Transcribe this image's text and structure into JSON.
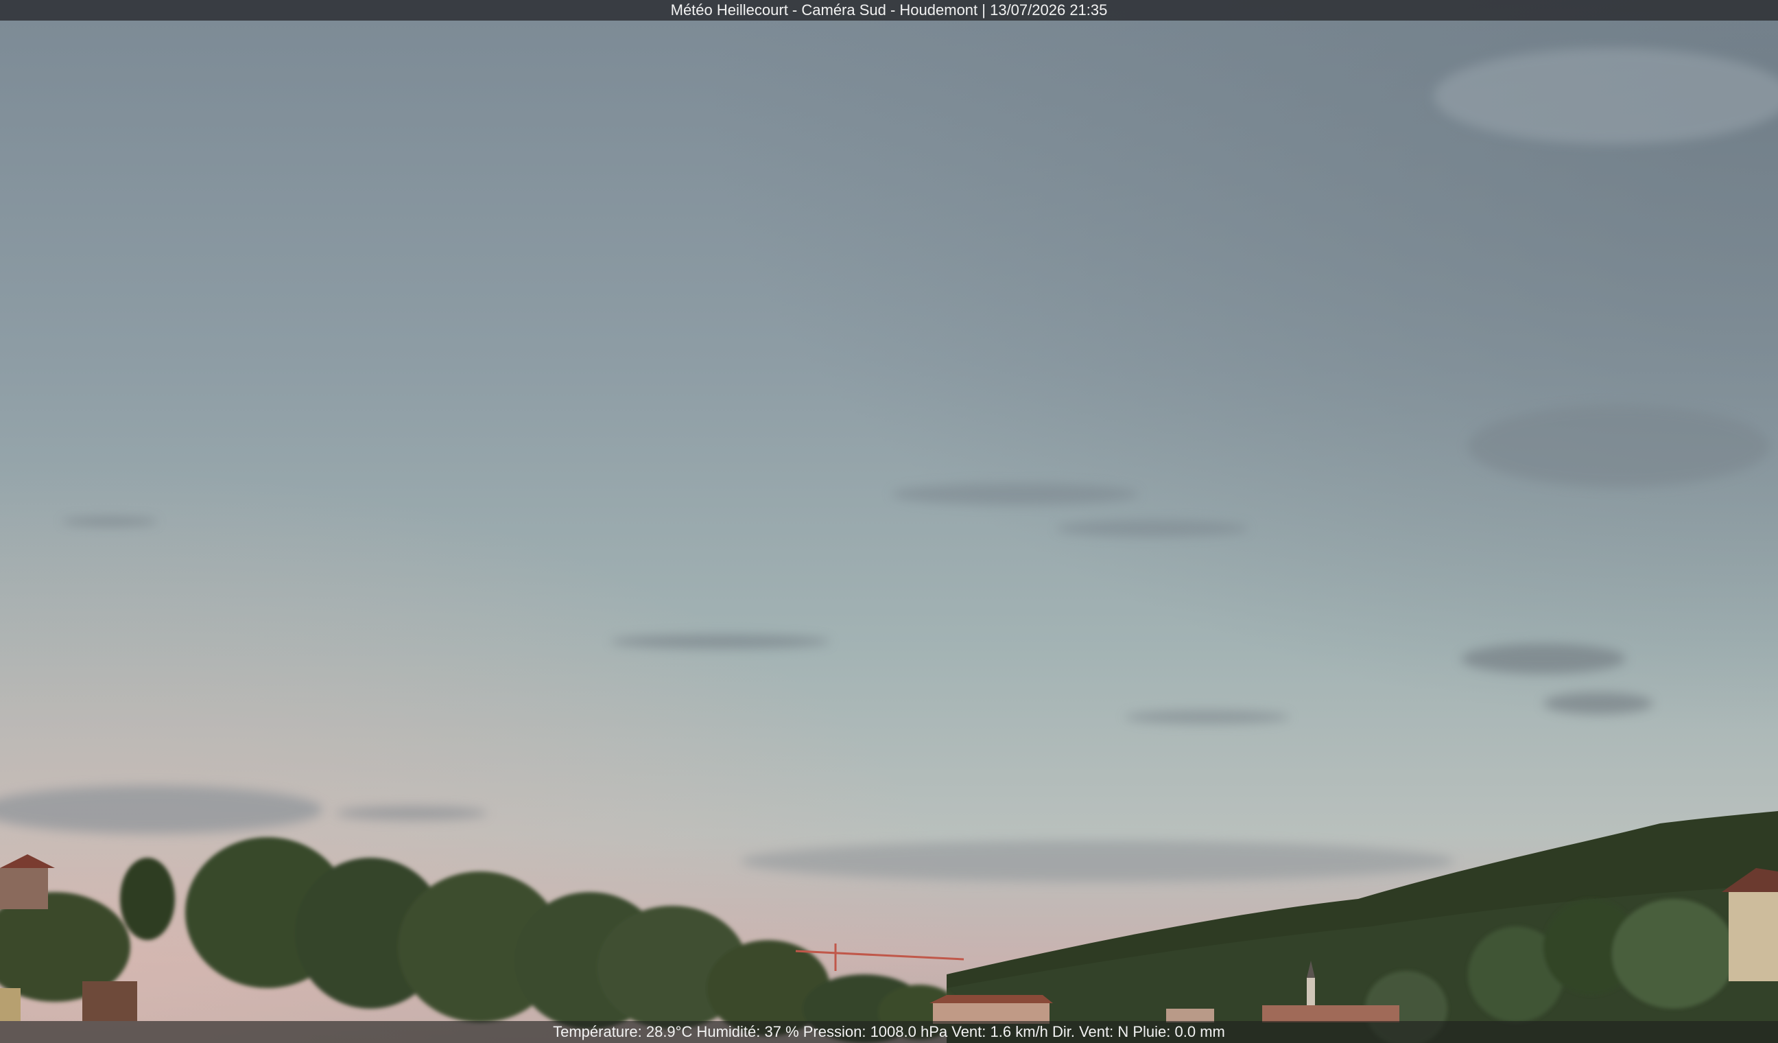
{
  "overlay": {
    "title": "Météo Heillecourt - Caméra Sud - Houdemont | 13/07/2026 21:35",
    "weather": "Température: 28.9°C  Humidité: 37 % Pression: 1008.0 hPa Vent: 1.6 km/h Dir. Vent: N Pluie: 0.0 mm"
  },
  "scene": {
    "description_icon": "webcam-image",
    "colors": {
      "sky_top": "#7c8a95",
      "sky_mid": "#98a8ae",
      "sky_low": "#b5bdbd",
      "sky_pink": "#c9b3b0",
      "hill_dark": "#2d3a22",
      "tree": "#3c4d2b",
      "roof": "#8a4a38"
    }
  }
}
